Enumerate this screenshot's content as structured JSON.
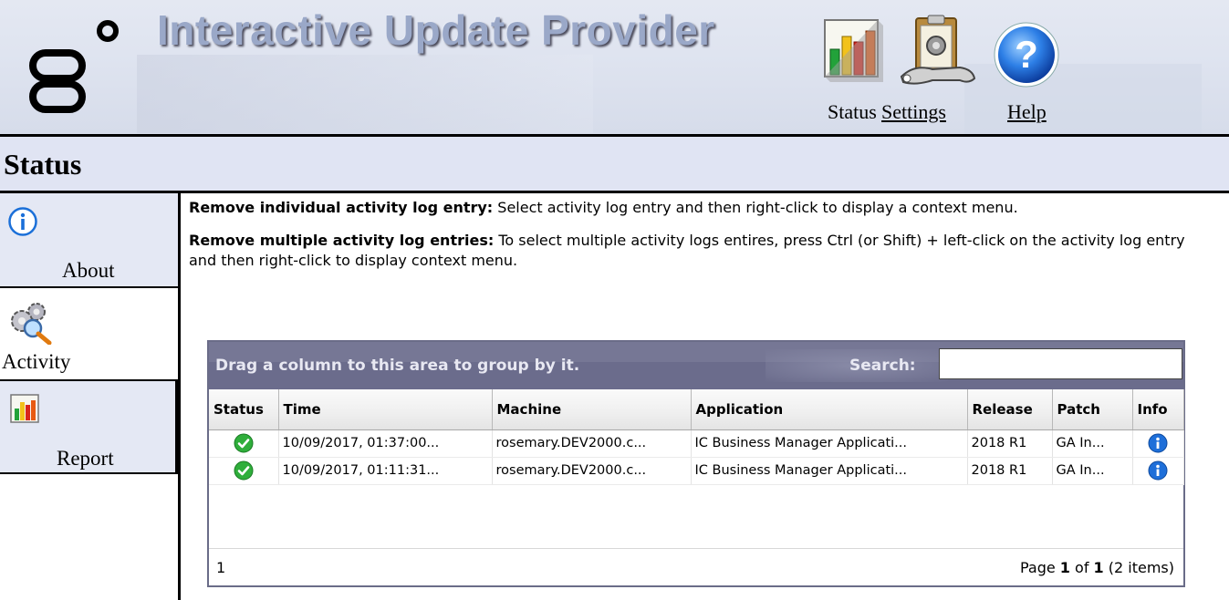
{
  "header": {
    "title": "Interactive Update Provider",
    "tools": [
      {
        "label": "Status",
        "icon": "status-chart-icon"
      },
      {
        "label": "Settings",
        "icon": "settings-clipboard-icon"
      },
      {
        "label": "Help",
        "icon": "help-icon"
      }
    ]
  },
  "section": {
    "title": "Status"
  },
  "nav": {
    "items": [
      {
        "label": "About",
        "icon": "info-circle-icon"
      },
      {
        "label": "Activity",
        "icon": "activity-gears-icon"
      },
      {
        "label": "Report",
        "icon": "report-chart-icon"
      }
    ]
  },
  "instructions": {
    "remove_single_title": "Remove individual activity log entry:",
    "remove_single_text": " Select activity log entry and then right-click to display a context menu.",
    "remove_multiple_title": "Remove multiple activity log entries:",
    "remove_multiple_text": " To select multiple activity logs entires, press Ctrl (or Shift) + left-click on the activity log entry and then right-click to display context menu."
  },
  "grid": {
    "group_hint": "Drag a column to this area to group by it.",
    "search_label": "Search:",
    "search_value": "",
    "columns": [
      "Status",
      "Time",
      "Machine",
      "Application",
      "Release",
      "Patch",
      "Info"
    ],
    "rows": [
      {
        "status": "success",
        "time": "10/09/2017, 01:37:00...",
        "machine": "rosemary.DEV2000.c...",
        "application": "IC Business Manager Applicati...",
        "release": "2018 R1",
        "patch": "GA In..."
      },
      {
        "status": "success",
        "time": "10/09/2017, 01:11:31...",
        "machine": "rosemary.DEV2000.c...",
        "application": "IC Business Manager Applicati...",
        "release": "2018 R1",
        "patch": "GA In..."
      }
    ],
    "footer": {
      "page_link": "1",
      "page_prefix": "Page ",
      "page_current": "1",
      "page_of": " of ",
      "page_total": "1",
      "items_text": " (2 items)"
    }
  },
  "colors": {
    "header_bg": "#dfe4f0",
    "title_text": "#9aa8c8",
    "section_bg": "#e0e4f3",
    "grid_header": "#6b6c8c",
    "success_green": "#2fae3b",
    "info_blue": "#1e6fd9"
  }
}
